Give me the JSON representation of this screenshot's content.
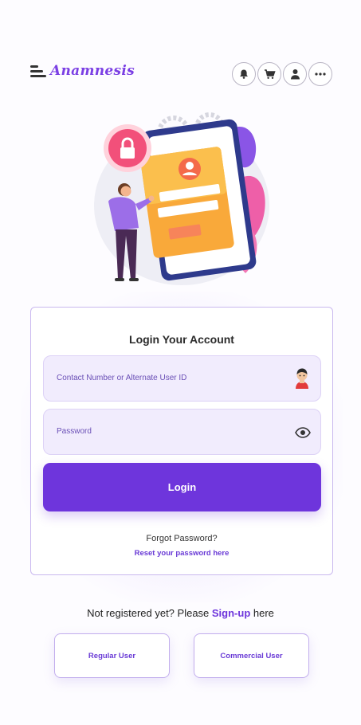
{
  "header": {
    "brand": "Anamnesis",
    "icons": [
      "bell-icon",
      "cart-icon",
      "user-icon",
      "more-icon"
    ]
  },
  "login": {
    "title": "Login Your Account",
    "contact_placeholder": "Contact Number or Alternate User ID",
    "password_placeholder": "Password",
    "login_label": "Login",
    "forgot_label": "Forgot Password?",
    "reset_label": "Reset your password here"
  },
  "signup": {
    "prefix": "Not registered yet? Please ",
    "link": "Sign-up",
    "suffix": " here",
    "regular_label": "Regular User",
    "commercial_label": "Commercial User"
  },
  "colors": {
    "accent": "#6e35dc",
    "field_bg": "#f1ecfd",
    "border": "#c9b8ef"
  }
}
